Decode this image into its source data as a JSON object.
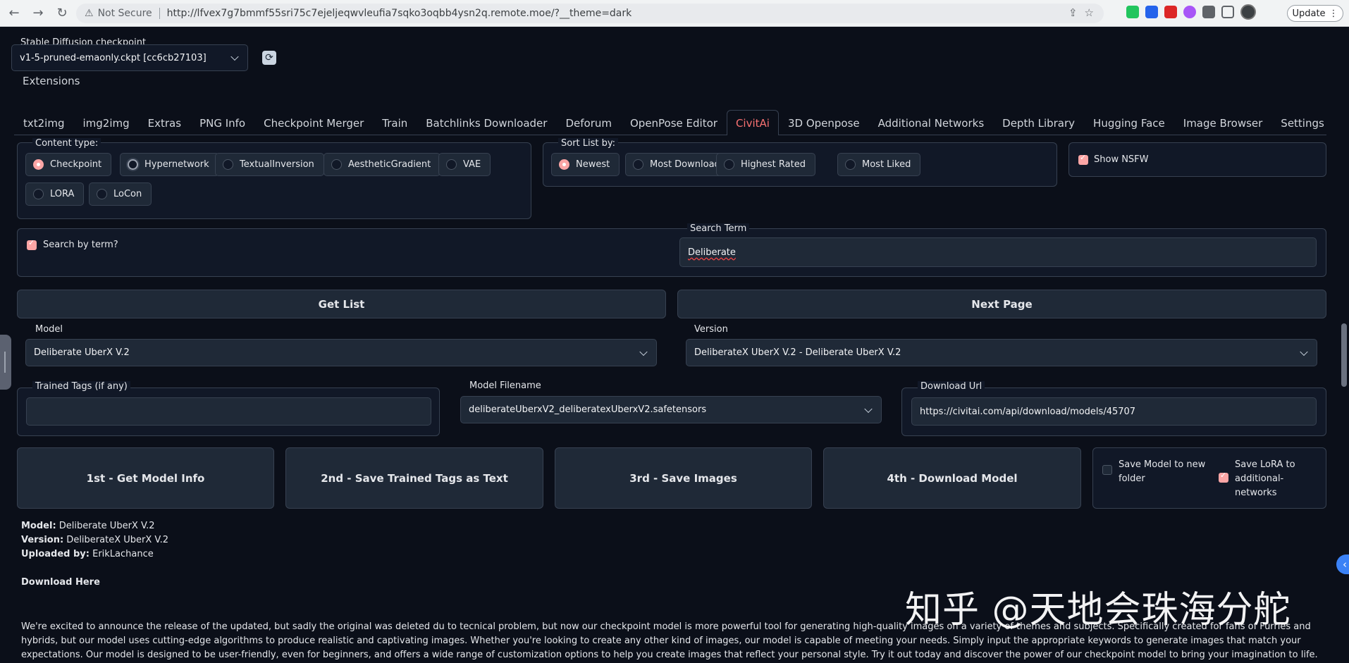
{
  "browser": {
    "security": "Not Secure",
    "url": "http://lfvex7g7bmmf55sri75c7ejeljeqwvleufia7sqko3oqbb4ysn2q.remote.moe/?__theme=dark",
    "update_label": "Update"
  },
  "checkpoint": {
    "label": "Stable Diffusion checkpoint",
    "value": "v1-5-pruned-emaonly.ckpt [cc6cb27103]"
  },
  "extensions_label": "Extensions",
  "tabs": [
    "txt2img",
    "img2img",
    "Extras",
    "PNG Info",
    "Checkpoint Merger",
    "Train",
    "Batchlinks Downloader",
    "Deforum",
    "OpenPose Editor",
    "CivitAi",
    "3D Openpose",
    "Additional Networks",
    "Depth Library",
    "Hugging Face",
    "Image Browser",
    "Settings"
  ],
  "active_tab": "CivitAi",
  "content_type": {
    "label": "Content type:",
    "options": [
      "Checkpoint",
      "Hypernetwork",
      "TextualInversion",
      "AestheticGradient",
      "VAE",
      "LORA",
      "LoCon"
    ],
    "selected": "Checkpoint"
  },
  "sort": {
    "label": "Sort List by:",
    "options": [
      "Newest",
      "Most Downloaded",
      "Highest Rated",
      "Most Liked"
    ],
    "selected": "Newest"
  },
  "nsfw": {
    "label": "Show NSFW",
    "checked": true
  },
  "search": {
    "checkbox_label": "Search by term?",
    "checked": true,
    "term_label": "Search Term",
    "term_value": "Deliberate"
  },
  "buttons": {
    "get_list": "Get List",
    "next_page": "Next Page",
    "get_info": "1st - Get Model Info",
    "save_tags": "2nd - Save Trained Tags as Text",
    "save_images": "3rd - Save Images",
    "download": "4th - Download Model"
  },
  "model": {
    "label": "Model",
    "value": "Deliberate UberX V.2"
  },
  "version": {
    "label": "Version",
    "value": "DeliberateX UberX V.2 - Deliberate UberX V.2"
  },
  "trained_tags": {
    "label": "Trained Tags (if any)",
    "value": ""
  },
  "model_filename": {
    "label": "Model Filename",
    "value": "deliberateUberxV2_deliberatexUberxV2.safetensors"
  },
  "download_url": {
    "label": "Download Url",
    "value": "https://civitai.com/api/download/models/45707"
  },
  "options": {
    "save_new_folder": "Save Model to new folder",
    "save_new_folder_checked": false,
    "save_lora": "Save LoRA to additional-networks",
    "save_lora_checked": true
  },
  "info": {
    "model_key": "Model:",
    "model_val": " Deliberate UberX V.2",
    "version_key": "Version:",
    "version_val": " DeliberateX UberX V.2",
    "uploaded_key": "Uploaded by:",
    "uploaded_val": " ErikLachance",
    "download_here": "Download Here"
  },
  "description": "We're excited to announce the release of the updated, but sadly the original was deleted du to tecnical problem, but now our checkpoint model is more powerful tool for generating high-quality images on a variety of themes and subjects. Specifically created for fans of Furries and hybrids, but our model uses cutting-edge algorithms to produce realistic and captivating images. Whether you're looking to create any other kind of images, our model is capable of meeting your needs. Simply input the appropriate keywords to generate images that match your expectations. Our model is designed to be user-friendly, even for beginners, and offers a wide range of customization options to help you create images that reflect your personal style. Try it out today and discover the power of our checkpoint model to bring your imagination to life. We also encourage users to share their creations and reactions in the comments section, and we look forward to",
  "watermark": "知乎 @天地会珠海分舵",
  "colors": {
    "accent": "#f87171",
    "checked": "#fca5a5",
    "background": "#0b0f19",
    "panel": "#111827"
  }
}
